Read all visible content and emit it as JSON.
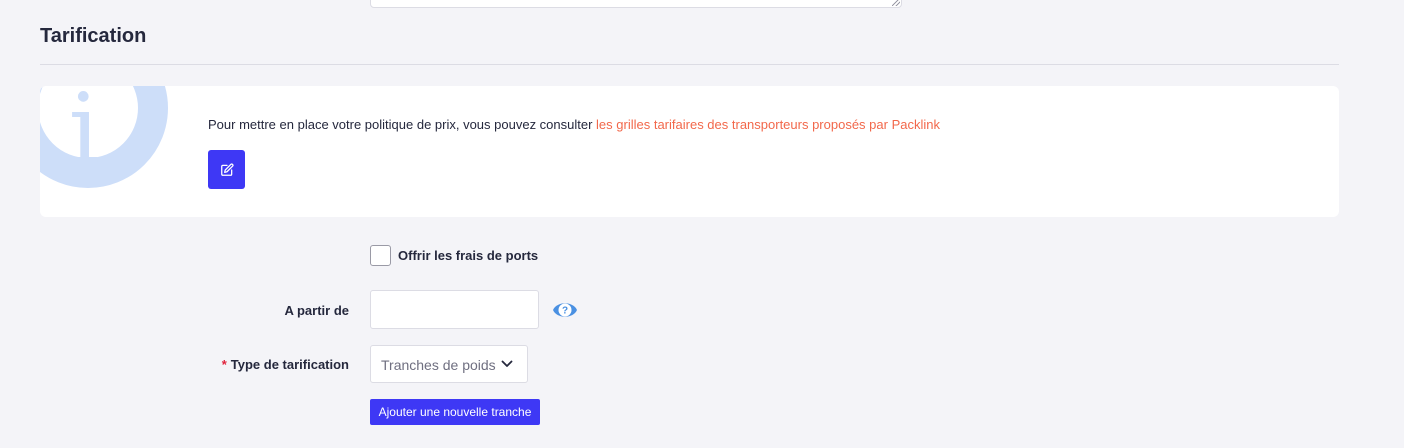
{
  "section": {
    "title": "Tarification"
  },
  "info": {
    "text": "Pour mettre en place votre politique de prix, vous pouvez consulter ",
    "link_text": "les grilles tarifaires des transporteurs proposés par Packlink",
    "icon": "info-icon",
    "edit_icon": "edit-icon"
  },
  "form": {
    "free_shipping": {
      "label": "Offrir les frais de ports",
      "checked": false
    },
    "from": {
      "label": "A partir de",
      "value": "",
      "help_icon": "help-icon"
    },
    "pricing_type": {
      "required_mark": "*",
      "label": "Type de tarification",
      "selected": "Tranches de poids"
    },
    "add_range_button": "Ajouter une nouvelle tranche"
  },
  "colors": {
    "accent": "#3e38f5",
    "link": "#f2684b",
    "info_graphic": "#cddef9",
    "help_icon": "#4a90e2",
    "required": "#e0223b"
  }
}
